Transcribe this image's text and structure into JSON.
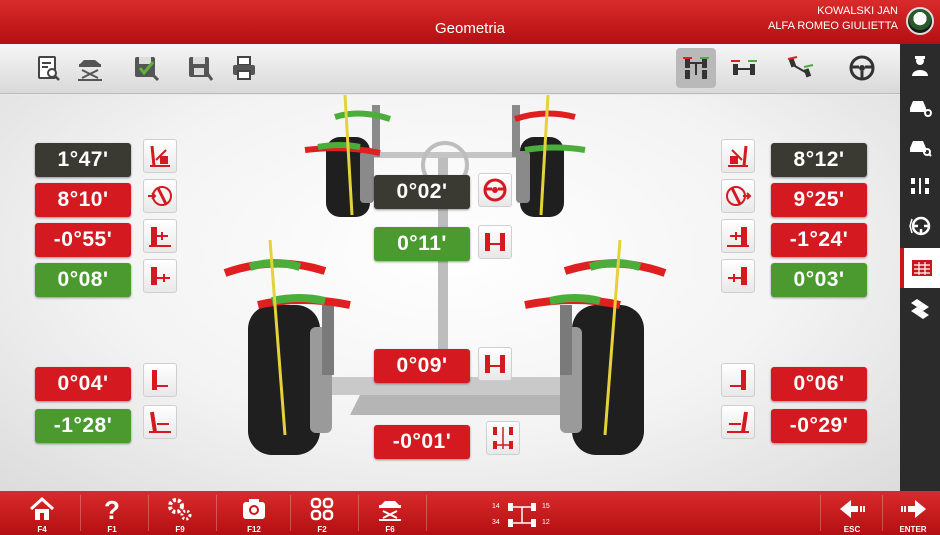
{
  "window": {
    "title": "Geometria",
    "user_name": "KOWALSKI JAN",
    "vehicle": "ALFA ROMEO GIULIETTA"
  },
  "toolbar": {
    "left_icons": [
      "report-search-icon",
      "car-lift-icon",
      "save-vehicle-icon",
      "save-settings-icon",
      "print-icon"
    ],
    "right_icons": [
      "front-axle-icon",
      "rear-axle-icon",
      "wheels-runout-icon",
      "steering-wheel-icon"
    ]
  },
  "sidebar": {
    "icons": [
      "technician-icon",
      "vehicle-settings-icon",
      "vehicle-search-icon",
      "axles-icon",
      "steering-icon",
      "measurements-table-icon",
      "grid-icon"
    ],
    "active_index": 5
  },
  "front_left": {
    "caster": "1°47'",
    "camber_sweep": "8°10'",
    "camber": "-0°55'",
    "toe": "0°08'"
  },
  "front_right": {
    "caster": "8°12'",
    "camber_sweep": "9°25'",
    "camber": "-1°24'",
    "toe": "0°03'"
  },
  "center": {
    "steering_angle": "0°02'",
    "front_total_toe": "0°11'",
    "rear_total_toe": "0°09'",
    "thrust_angle": "-0°01'"
  },
  "rear_left": {
    "toe": "0°04'",
    "camber": "-1°28'"
  },
  "rear_right": {
    "toe": "0°06'",
    "camber": "-0°29'"
  },
  "bottom_bar": {
    "keys": [
      {
        "icon": "home-icon",
        "label": "F4"
      },
      {
        "icon": "help-icon",
        "label": "F1"
      },
      {
        "icon": "settings-icon",
        "label": "F9"
      },
      {
        "icon": "camera-icon",
        "label": "F12"
      },
      {
        "icon": "grid-menu-icon",
        "label": "F2"
      },
      {
        "icon": "car-lift-icon",
        "label": "F6"
      }
    ],
    "axle_numbers": [
      "14",
      "15",
      "34",
      "12"
    ],
    "esc_label": "ESC",
    "enter_label": "ENTER"
  },
  "colors": {
    "red": "#d41a20",
    "green": "#4a9a2f",
    "dark": "#3a3a33",
    "brand_red": "#c8161d"
  }
}
